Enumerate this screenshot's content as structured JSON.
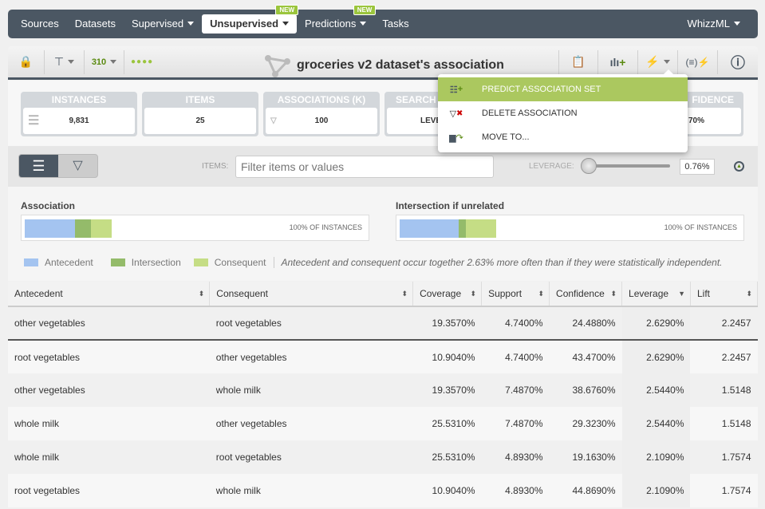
{
  "nav": {
    "items": [
      "Sources",
      "Datasets",
      "Supervised",
      "Unsupervised",
      "Predictions",
      "Tasks"
    ],
    "new_badge": "NEW",
    "right": "WhizzML"
  },
  "toolbar": {
    "title": "groceries v2 dataset's association"
  },
  "stats": [
    {
      "label": "INSTANCES",
      "value": "9,831"
    },
    {
      "label": "ITEMS",
      "value": "25"
    },
    {
      "label": "ASSOCIATIONS (K)",
      "value": "100"
    },
    {
      "label": "SEARCH",
      "value": "LEVE"
    },
    {
      "label": "FIDENCE",
      "value": "70%"
    }
  ],
  "menu": {
    "items": [
      "PREDICT ASSOCIATION SET",
      "DELETE ASSOCIATION",
      "MOVE TO..."
    ]
  },
  "filter": {
    "items_label": "ITEMS:",
    "placeholder": "Filter items or values",
    "leverage_label": "LEVERAGE:",
    "leverage_value": "0.76%"
  },
  "assoc": {
    "association_label": "Association",
    "intersection_label": "Intersection if unrelated",
    "pct_label": "100% OF INSTANCES",
    "legend": [
      "Antecedent",
      "Intersection",
      "Consequent"
    ],
    "note": "Antecedent and consequent occur together 2.63% more often than if they were statistically independent.",
    "colors": {
      "antecedent": "#a4c4f0",
      "intersection": "#94bb6a",
      "consequent": "#c5dd85"
    }
  },
  "table": {
    "headers": [
      "Antecedent",
      "Consequent",
      "Coverage",
      "Support",
      "Confidence",
      "Leverage",
      "Lift"
    ],
    "rows": [
      [
        "other vegetables",
        "root vegetables",
        "19.3570%",
        "4.7400%",
        "24.4880%",
        "2.6290%",
        "2.2457"
      ],
      [
        "root vegetables",
        "other vegetables",
        "10.9040%",
        "4.7400%",
        "43.4700%",
        "2.6290%",
        "2.2457"
      ],
      [
        "other vegetables",
        "whole milk",
        "19.3570%",
        "7.4870%",
        "38.6760%",
        "2.5440%",
        "1.5148"
      ],
      [
        "whole milk",
        "other vegetables",
        "25.5310%",
        "7.4870%",
        "29.3230%",
        "2.5440%",
        "1.5148"
      ],
      [
        "whole milk",
        "root vegetables",
        "25.5310%",
        "4.8930%",
        "19.1630%",
        "2.1090%",
        "1.7574"
      ],
      [
        "root vegetables",
        "whole milk",
        "10.9040%",
        "4.8930%",
        "44.8690%",
        "2.1090%",
        "1.7574"
      ]
    ]
  }
}
